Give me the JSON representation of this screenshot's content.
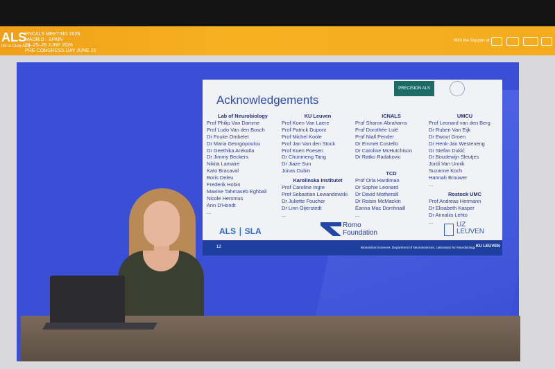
{
  "banner": {
    "logo": "ALS",
    "tagline": "Hit to Cure ALS",
    "event_lines": [
      "ENCALS MEETING 2026",
      "MADRID · SPAIN",
      "24–25–26 JUNE 2026",
      "PRE-CONGRESS DAY JUNE 23"
    ],
    "support_text": "With the Support of"
  },
  "slide": {
    "title": "Acknowledgements",
    "badge": "PRECISION ALS",
    "columns": [
      {
        "groups": [
          {
            "heading": "Lab of Neurobiology",
            "names": [
              "Prof Philip Van Damme",
              "Prof Ludo Van den Bosch",
              "Dr Fouke Ombelet",
              "Dr Maria Georgopoulou",
              "Dr Geethika Arekatla",
              "Dr Jimmy Beckers",
              "Nikita Lamaire",
              "Kato Bracaval",
              "Boris Deleu",
              "Frederik Hobin",
              "Maxine Tahmaseb Eghbali",
              "Nicole Hersmus",
              "Ann D'Hondt",
              "..."
            ]
          }
        ]
      },
      {
        "groups": [
          {
            "heading": "KU Leuven",
            "names": [
              "Prof Koen Van Laere",
              "Prof Patrick Dupont",
              "Prof Michel Koole",
              "Prof Jan Van den Stock",
              "Prof Koen Poesen",
              "Dr Chunmeng Tang",
              "Dr Jiaze Sun",
              "Jonas Dubin"
            ]
          },
          {
            "heading": "Karolinska Institutet",
            "names": [
              "Prof Caroline Ingre",
              "Prof Sebastian Lewandowski",
              "Dr Juliette Foucher",
              "Dr Linn Öijerstedt",
              "..."
            ]
          }
        ]
      },
      {
        "groups": [
          {
            "heading": "ICNALS",
            "names": [
              "Prof Sharon Abrahams",
              "Prof Dorothée Lulé",
              "Prof Niall Pender",
              "Dr Emmet Costello",
              "Dr Caroline McHutchison",
              "Dr Ratko Radakovic"
            ]
          },
          {
            "heading": "TCD",
            "names": [
              "Prof Orla Hardiman",
              "Dr Sophie Leonard",
              "Dr David Mothersill",
              "Dr Roisin McMackin",
              "Éanna Mac Domhnaill",
              "..."
            ]
          }
        ]
      },
      {
        "groups": [
          {
            "heading": "UMCU",
            "names": [
              "Prof Leonard van den Berg",
              "Dr Ruben Van Eijk",
              "Dr Ewout Groen",
              "Dr Henk-Jan Westeneng",
              "Dr Stefan Dukić",
              "Dr Boudewijn Sleutjes",
              "Jordi Van Unnik",
              "Suzanne Koch",
              "Hannah Brouwer",
              "..."
            ]
          },
          {
            "heading": "Rostock UMC",
            "names": [
              "Prof Andreas Hermann",
              "Dr Elisabeth Kasper",
              "Dr Annaliis Lehto",
              "..."
            ]
          }
        ]
      }
    ],
    "logos": {
      "als": "ALS ∣ SLA",
      "romo": [
        "Romo",
        "Foundation"
      ],
      "uz": [
        "UZ",
        "LEUVEN"
      ]
    },
    "footer": {
      "page": "12",
      "affiliation": "Biomedical Sciences, Department of Neurosciences, Laboratory for Neurobiology",
      "brand": "KU LEUVEN"
    }
  }
}
